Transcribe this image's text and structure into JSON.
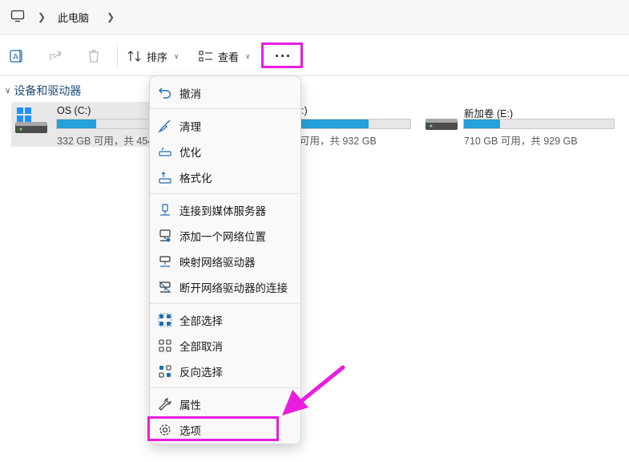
{
  "address": {
    "crumb": "此电脑"
  },
  "toolbar": {
    "sort_label": "排序",
    "view_label": "查看",
    "more_label": "···"
  },
  "section": {
    "title": "设备和驱动器"
  },
  "drives": [
    {
      "name": "OS (C:)",
      "space": "332 GB 可用，共 454",
      "used_fraction": 0.27
    },
    {
      "name": ":)",
      "space": "可用，共 932 GB",
      "used_fraction": 0.63
    },
    {
      "name": "新加卷 (E:)",
      "space": "710 GB 可用，共 929 GB",
      "used_fraction": 0.24
    }
  ],
  "menu": {
    "items": [
      {
        "label": "撤消"
      },
      {
        "label": "清理"
      },
      {
        "label": "优化"
      },
      {
        "label": "格式化"
      },
      {
        "label": "连接到媒体服务器"
      },
      {
        "label": "添加一个网络位置"
      },
      {
        "label": "映射网络驱动器"
      },
      {
        "label": "断开网络驱动器的连接"
      },
      {
        "label": "全部选择"
      },
      {
        "label": "全部取消"
      },
      {
        "label": "反向选择"
      },
      {
        "label": "属性"
      },
      {
        "label": "选项"
      }
    ]
  },
  "colors": {
    "accent": "#26a0da",
    "highlight": "#e81de0",
    "icon_blue": "#1f6fb5"
  }
}
